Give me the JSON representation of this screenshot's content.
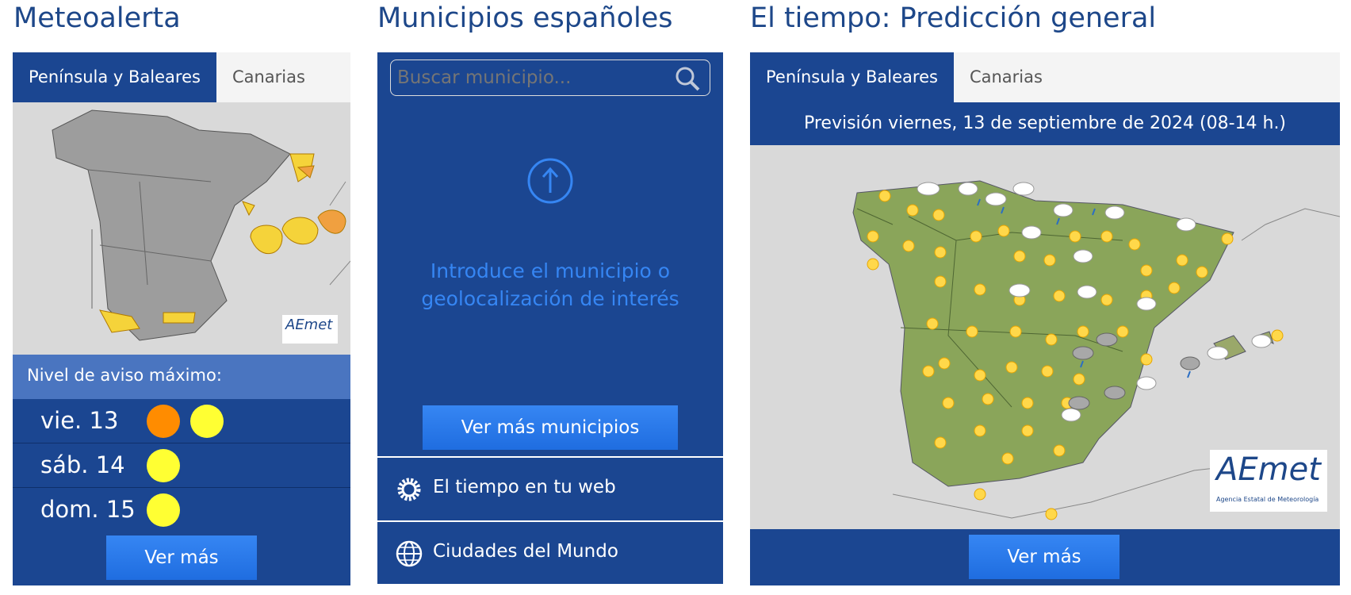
{
  "meteoalerta": {
    "title": "Meteoalerta",
    "tabs": [
      "Península y Baleares",
      "Canarias"
    ],
    "nivel_label": "Nivel de aviso máximo:",
    "days": [
      {
        "label": "vie. 13",
        "levels": [
          "orange",
          "yellow"
        ]
      },
      {
        "label": "sáb. 14",
        "levels": [
          "yellow"
        ]
      },
      {
        "label": "dom. 15",
        "levels": [
          "yellow"
        ]
      }
    ],
    "button": "Ver más",
    "logo_text": "AEmet"
  },
  "municipios": {
    "title": "Municipios españoles",
    "search_placeholder": "Buscar municipio...",
    "prompt_line1": "Introduce el municipio o",
    "prompt_line2": "geolocalización de interés",
    "button": "Ver más municipios",
    "links": [
      "El tiempo en tu web",
      "Ciudades del Mundo"
    ]
  },
  "prediccion": {
    "title": "El tiempo: Predicción general",
    "tabs": [
      "Península y Baleares",
      "Canarias"
    ],
    "subtitle": "Previsión viernes, 13 de septiembre de 2024 (08-14 h.)",
    "button": "Ver más",
    "logo_text": "AEmet",
    "logo_subtext": "Agencia Estatal de Meteorología"
  },
  "colors": {
    "panel": "#1b4691",
    "orange": "#ff8c00",
    "yellow": "#ffff33",
    "accent": "#3686f3"
  }
}
